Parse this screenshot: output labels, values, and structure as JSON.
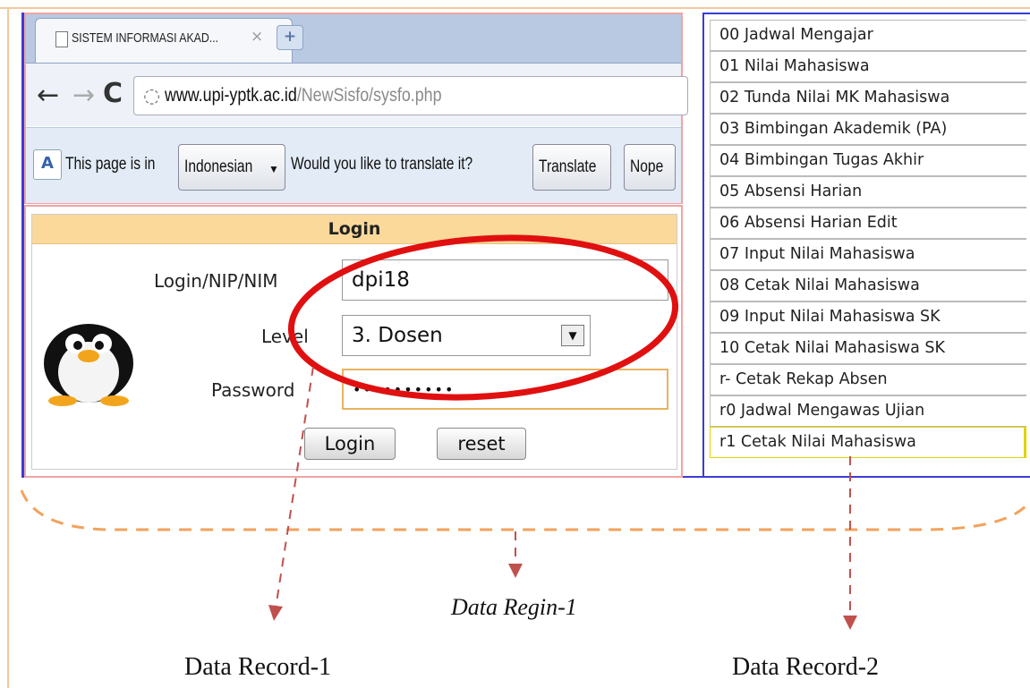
{
  "browser": {
    "tab_title": "SISTEM INFORMASI AKAD...",
    "tab_close": "×",
    "new_tab": "+",
    "url_host": "www.upi-yptk.ac.id",
    "url_path": "/NewSisfo/sysfo.php",
    "translate_bar": {
      "prefix": "This page is in",
      "language": "Indonesian",
      "question": "Would you like to translate it?",
      "translate_label": "Translate",
      "nope_label": "Nope"
    }
  },
  "login": {
    "header": "Login",
    "nip_label": "Login/NIP/NIM",
    "nip_value": "dpi18",
    "level_label": "Level",
    "level_value": "3. Dosen",
    "password_label": "Password",
    "password_value": "••••••••••",
    "login_button": "Login",
    "reset_button": "reset"
  },
  "menu": {
    "items": [
      "00 Jadwal Mengajar",
      "01 Nilai Mahasiswa",
      "02 Tunda Nilai MK Mahasiswa",
      "03 Bimbingan Akademik (PA)",
      "04 Bimbingan Tugas Akhir",
      "05 Absensi Harian",
      "06 Absensi Harian Edit",
      "07 Input Nilai Mahasiswa",
      "08 Cetak Nilai Mahasiswa",
      "09 Input Nilai Mahasiswa SK",
      "10 Cetak Nilai Mahasiswa SK",
      "r- Cetak Rekap Absen",
      "r0 Jadwal Mengawas Ujian",
      "r1 Cetak Nilai Mahasiswa"
    ]
  },
  "annotations": {
    "region": "Data Regin-1",
    "record1": "Data Record-1",
    "record2": "Data Record-2"
  },
  "colors": {
    "highlight_ellipse": "#e01010",
    "dashed_brace": "#f2a25c",
    "dashed_arrow": "#c0504d",
    "frame_blue": "#3b3bd6",
    "frame_pink": "#f2a3a3"
  }
}
